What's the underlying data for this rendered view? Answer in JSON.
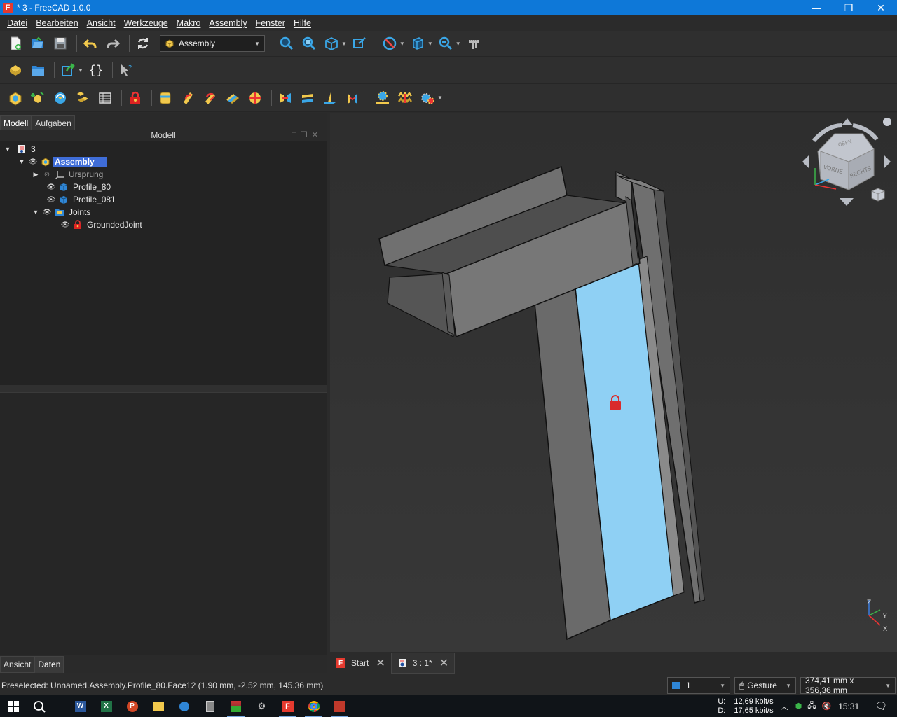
{
  "window": {
    "title": "* 3 - FreeCAD 1.0.0",
    "app_icon_letter": "F",
    "controls": [
      "—",
      "❐",
      "✕"
    ]
  },
  "menu": [
    "Datei",
    "Bearbeiten",
    "Ansicht",
    "Werkzeuge",
    "Makro",
    "Assembly",
    "Fenster",
    "Hilfe"
  ],
  "workbench_selector": {
    "value": "Assembly"
  },
  "left_panel": {
    "tabs": [
      "Modell",
      "Aufgaben"
    ],
    "header": "Modell",
    "tree": [
      {
        "label": "3"
      },
      {
        "label": "Assembly"
      },
      {
        "label": "Ursprung"
      },
      {
        "label": "Profile_80"
      },
      {
        "label": "Profile_081"
      },
      {
        "label": "Joints"
      },
      {
        "label": "GroundedJoint"
      }
    ],
    "bottom_tabs": [
      "Ansicht",
      "Daten"
    ]
  },
  "navcube": {
    "top_label": "OBEN",
    "front_label": "VORNE",
    "right_label": "RECHTS"
  },
  "axes": {
    "z": "Z",
    "y": "Y",
    "x": "X"
  },
  "doc_tabs": [
    {
      "label": "Start"
    },
    {
      "label": "3 : 1*"
    }
  ],
  "status": {
    "message": "Preselected: Unnamed.Assembly.Profile_80.Face12 (1.90 mm, -2.52 mm, 145.36 mm)",
    "layer": "1",
    "nav_style": "Gesture",
    "dimensions": "374,41 mm x 356,36 mm"
  },
  "taskbar": {
    "upload_label": "U:",
    "upload": "12,69 kbit/s",
    "download_label": "D:",
    "download": "17,65 kbit/s",
    "clock": "15:31"
  },
  "colors": {
    "accent": "#0e78d8",
    "selection": "#3f6dd8",
    "face_highlight": "#8fd0f4",
    "profile": "#737373"
  }
}
